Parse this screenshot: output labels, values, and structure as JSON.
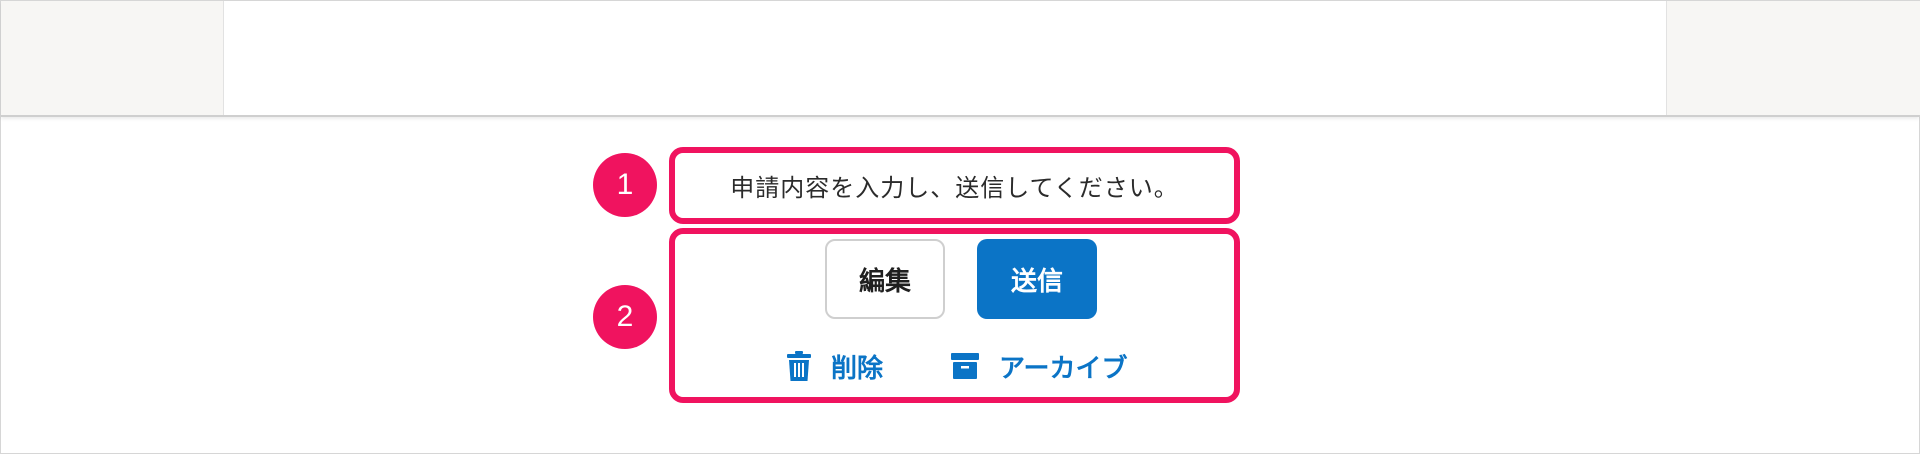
{
  "instruction": {
    "text": "申請内容を入力し、送信してください。"
  },
  "markers": {
    "one": "1",
    "two": "2"
  },
  "buttons": {
    "edit_label": "編集",
    "send_label": "送信"
  },
  "actions": {
    "delete_label": "削除",
    "archive_label": "アーカイブ"
  },
  "icons": {
    "delete": "trash-icon",
    "archive": "archive-box-icon"
  },
  "colors": {
    "highlight": "#f0135f",
    "primary": "#0b74c6",
    "header_panel": "#f7f6f4"
  }
}
